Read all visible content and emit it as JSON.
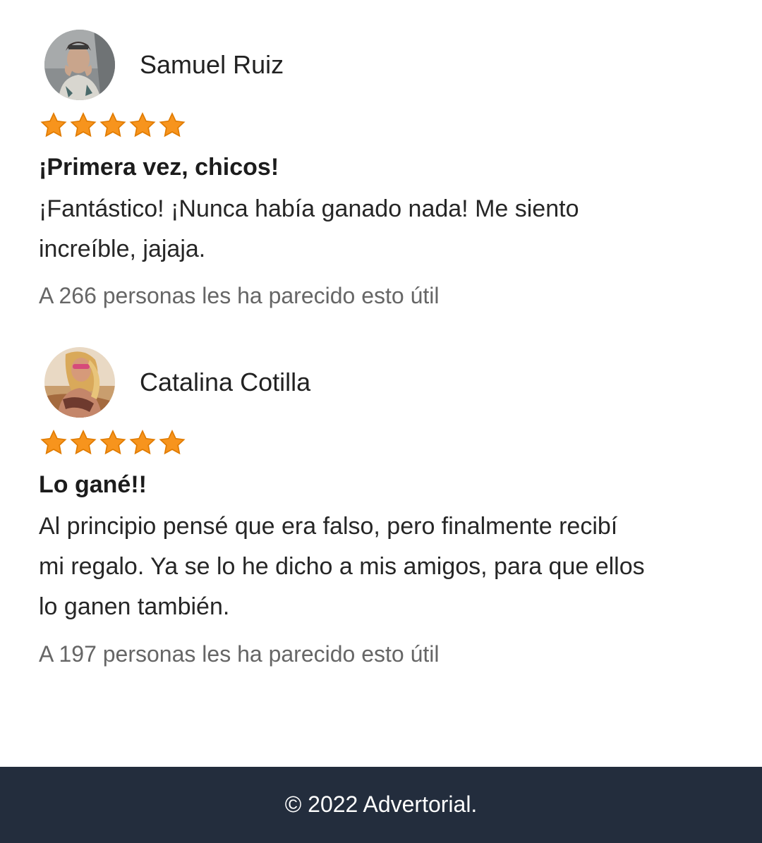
{
  "accent_colors": {
    "star_fill": "#f7941d",
    "star_stroke": "#e07b00",
    "footer_background": "#232d3d"
  },
  "reviews": [
    {
      "reviewer_name": "Samuel Ruiz",
      "avatar": "user-photo",
      "rating": 5,
      "title": "¡Primera vez, chicos!",
      "body_lines": [
        "¡Fantástico! ¡Nunca había ganado nada! Me siento",
        "increíble, jajaja."
      ],
      "helpful_text": "A 266 personas les ha parecido esto útil"
    },
    {
      "reviewer_name": "Catalina Cotilla",
      "avatar": "user-photo",
      "rating": 5,
      "title": "Lo gané!!",
      "body_lines": [
        "Al principio pensé que era falso, pero finalmente recibí",
        "mi regalo. Ya se lo he dicho a mis amigos, para que ellos",
        "lo ganen también."
      ],
      "helpful_text": "A 197 personas les ha parecido esto útil"
    }
  ],
  "footer": {
    "copyright": "© 2022 Advertorial."
  }
}
